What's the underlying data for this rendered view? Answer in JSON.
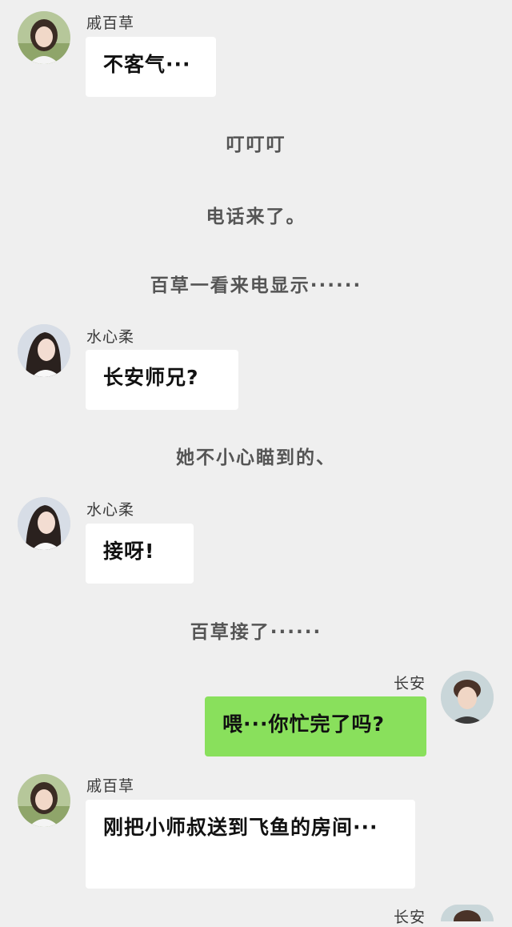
{
  "messages": [
    {
      "speaker": "戚百草",
      "text": "不客气···"
    },
    {
      "narration": "叮叮叮"
    },
    {
      "narration": "电话来了。"
    },
    {
      "narration": "百草一看来电显示······"
    },
    {
      "speaker": "水心柔",
      "text": "长安师兄?"
    },
    {
      "narration": "她不小心瞄到的、"
    },
    {
      "speaker": "水心柔",
      "text": "接呀!"
    },
    {
      "narration": "百草接了······"
    },
    {
      "speaker": "长安",
      "text": "喂···你忙完了吗?"
    },
    {
      "speaker": "戚百草",
      "text": "刚把小师叔送到飞鱼的房间···"
    },
    {
      "speaker": "长安"
    }
  ],
  "icons": {
    "avatar_qi_baicao": "avatar-girl-icon",
    "avatar_shui_xinrou": "avatar-girl-icon",
    "avatar_changan": "avatar-boy-icon"
  },
  "colors": {
    "background": "#efefef",
    "incoming_bubble": "#ffffff",
    "outgoing_bubble": "#89e05c"
  }
}
